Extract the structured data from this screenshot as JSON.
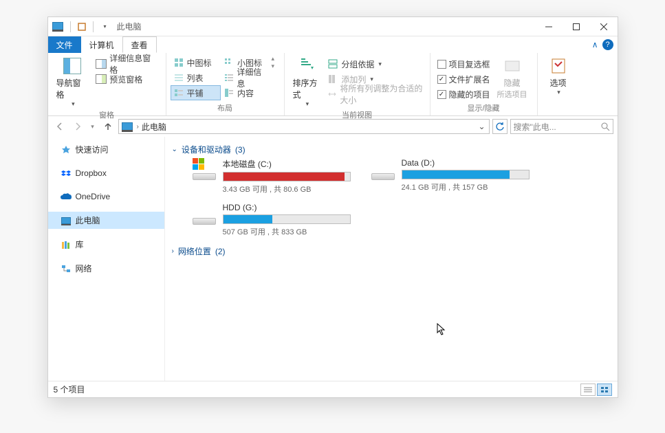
{
  "titlebar": {
    "title": "此电脑"
  },
  "tabs": {
    "file": "文件",
    "computer": "计算机",
    "view": "查看"
  },
  "ribbon": {
    "panes": {
      "label": "窗格",
      "nav_pane": "导航窗格",
      "details_pane": "详细信息窗格",
      "preview_pane": "预览窗格"
    },
    "layout": {
      "label": "布局",
      "medium_icons": "中图标",
      "small_icons": "小图标",
      "list": "列表",
      "details": "详细信息",
      "tiles": "平铺",
      "content": "内容"
    },
    "current_view": {
      "label": "当前视图",
      "sort_by": "排序方式",
      "group_by": "分组依据",
      "add_columns": "添加列",
      "size_columns": "将所有列调整为合适的大小"
    },
    "show_hide": {
      "label": "显示/隐藏",
      "item_checkboxes": "项目复选框",
      "file_ext": "文件扩展名",
      "hidden_items": "隐藏的项目",
      "hide": "隐藏",
      "hide_sub": "所选项目"
    },
    "options": {
      "label": "选项"
    }
  },
  "address": {
    "crumb": "此电脑"
  },
  "search": {
    "placeholder": "搜索\"此电..."
  },
  "sidebar": {
    "quick_access": "快速访问",
    "dropbox": "Dropbox",
    "onedrive": "OneDrive",
    "this_pc": "此电脑",
    "libraries": "库",
    "network": "网络"
  },
  "content": {
    "drives_group": {
      "title": "设备和驱动器",
      "count": "(3)"
    },
    "network_group": {
      "title": "网络位置",
      "count": "(2)"
    },
    "drives": [
      {
        "name": "本地磁盘 (C:)",
        "sub": "3.43 GB 可用 , 共 80.6 GB",
        "fill_pct": 96,
        "color": "#d22f2f",
        "windows_badge": true
      },
      {
        "name": "Data (D:)",
        "sub": "24.1 GB 可用 , 共 157 GB",
        "fill_pct": 85,
        "color": "#1ba0e1",
        "windows_badge": false
      },
      {
        "name": "HDD (G:)",
        "sub": "507 GB 可用 , 共 833 GB",
        "fill_pct": 39,
        "color": "#1ba0e1",
        "windows_badge": false
      }
    ]
  },
  "status": {
    "items": "5 个项目"
  }
}
